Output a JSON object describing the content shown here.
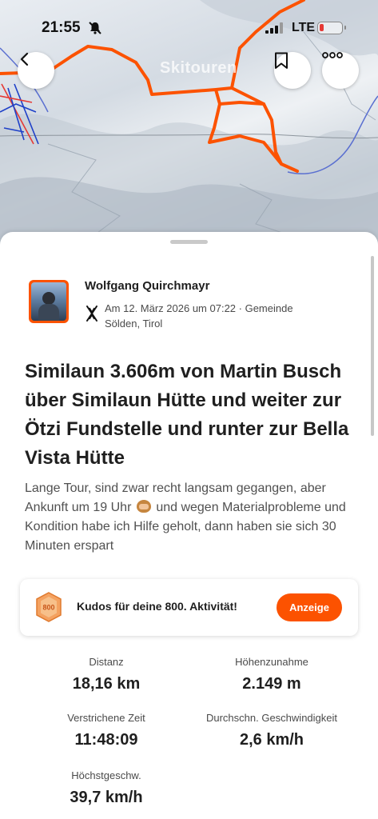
{
  "status_bar": {
    "time": "21:55",
    "network": "LTE"
  },
  "map": {
    "overlay_label": "Skitouren",
    "route_color": "#fc5200"
  },
  "activity": {
    "athlete_name": "Wolfgang Quirchmayr",
    "sport_icon": "ski-touring-icon",
    "meta": "Am 12. März 2026 um 07:22 · Gemeinde Sölden, Tirol",
    "title": "Similaun 3.606m von Martin Busch über Similaun Hütte und weiter zur Ötzi Fundstelle und runter zur Bella Vista Hütte",
    "description_part1": "Lange Tour, sind zwar recht langsam gegangen, aber Ankunft um 19 Uhr",
    "description_emoji": "see-no-evil-monkey",
    "description_part2": "und wegen Materialprobleme und Kondition habe ich Hilfe geholt, dann haben sie sich 30 Minuten erspart"
  },
  "kudos": {
    "badge_number": "800",
    "text": "Kudos für deine 800. Aktivität!",
    "button_label": "Anzeige"
  },
  "stats": [
    {
      "label": "Distanz",
      "value": "18,16 km"
    },
    {
      "label": "Höhenzunahme",
      "value": "2.149 m"
    },
    {
      "label": "Verstrichene Zeit",
      "value": "11:48:09"
    },
    {
      "label": "Durchschn. Geschwindigkeit",
      "value": "2,6 km/h"
    },
    {
      "label": "Höchstgeschw.",
      "value": "39,7 km/h"
    }
  ],
  "colors": {
    "accent": "#fc5200",
    "text": "#1f1f1f",
    "muted": "#505050"
  }
}
